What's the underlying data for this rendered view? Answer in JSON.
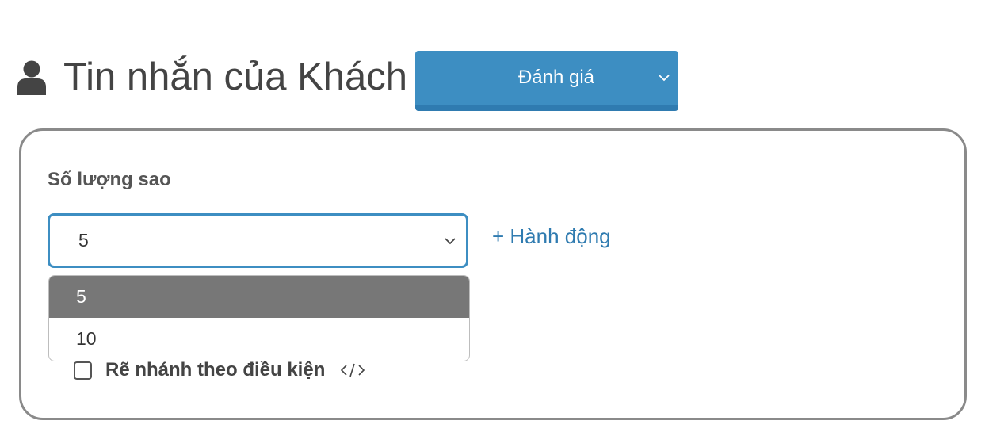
{
  "header": {
    "icon": "user-icon",
    "title": "Tin nhắn của Khách",
    "type_select": {
      "value": "Đánh giá",
      "icon": "chevron-down-icon",
      "color": "#3d8ec2"
    }
  },
  "panel": {
    "stars_field": {
      "label": "Số lượng sao",
      "value": "5",
      "icon": "chevron-down-icon",
      "options": [
        "5",
        "10"
      ],
      "highlighted_option": "5"
    },
    "add_action_label": "+ Hành động",
    "branch_checkbox": {
      "label": "Rẽ nhánh theo điều kiện",
      "checked": false,
      "icon": "code-icon"
    }
  },
  "colors": {
    "accent": "#3d8ec2",
    "link": "#2f7bb0",
    "highlight": "#777777"
  }
}
